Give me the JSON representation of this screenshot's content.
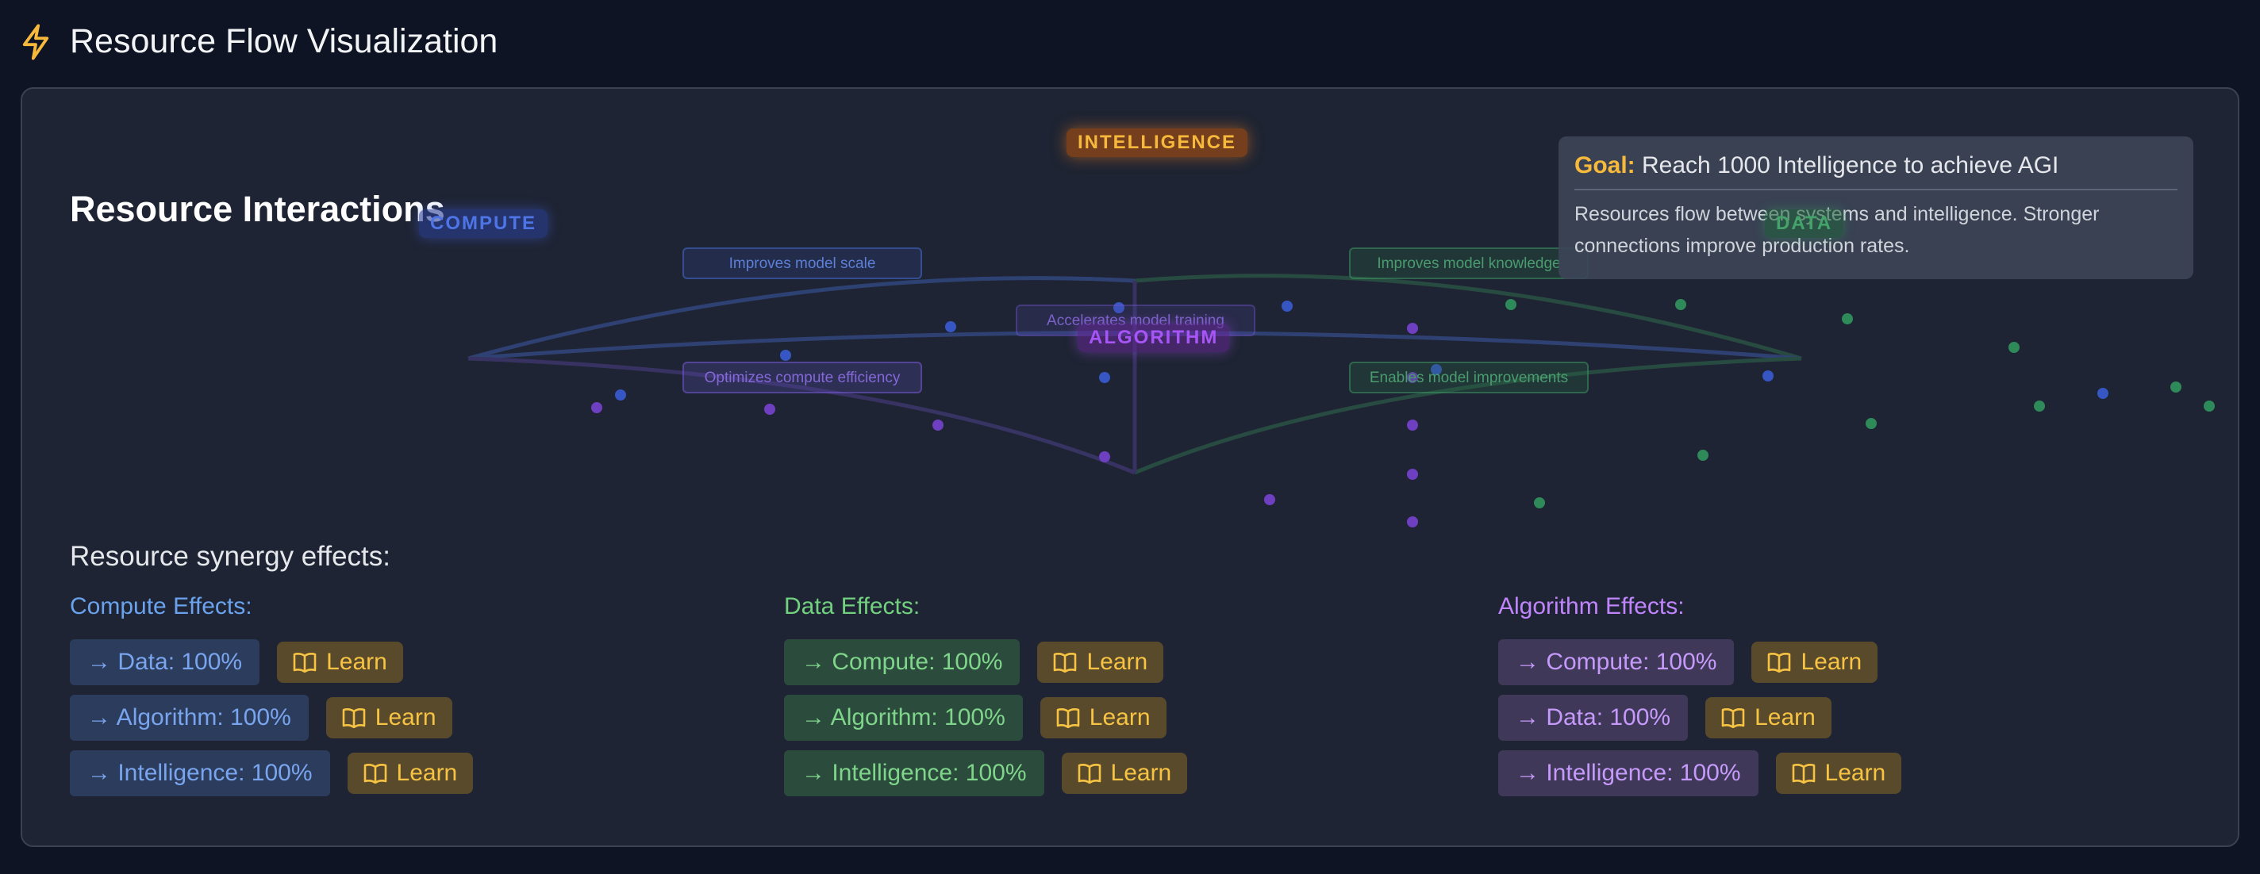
{
  "header": {
    "title": "Resource Flow Visualization",
    "icon": "lightning-bolt-icon"
  },
  "panel": {
    "section_title": "Resource Interactions",
    "goal": {
      "label": "Goal:",
      "text": "Reach 1000 Intelligence to achieve AGI",
      "description": "Resources flow between systems and intelligence. Stronger connections improve production rates."
    },
    "nodes": {
      "intelligence": "INTELLIGENCE",
      "compute": "COMPUTE",
      "data": "DATA",
      "algorithm": "ALGORITHM"
    },
    "edge_labels": {
      "compute_top": "Improves model scale",
      "compute_bottom": "Optimizes compute efficiency",
      "data_top": "Improves model knowledge",
      "data_bottom": "Enables model improvements",
      "center": "Accelerates model training"
    },
    "synergy_title": "Resource synergy effects:",
    "columns": [
      {
        "title": "Compute Effects:",
        "effects": [
          {
            "label": "→ Data: 100%",
            "learn": "Learn"
          },
          {
            "label": "→ Algorithm: 100%",
            "learn": "Learn"
          },
          {
            "label": "→ Intelligence: 100%",
            "learn": "Learn"
          }
        ]
      },
      {
        "title": "Data Effects:",
        "effects": [
          {
            "label": "→ Compute: 100%",
            "learn": "Learn"
          },
          {
            "label": "→ Algorithm: 100%",
            "learn": "Learn"
          },
          {
            "label": "→ Intelligence: 100%",
            "learn": "Learn"
          }
        ]
      },
      {
        "title": "Algorithm Effects:",
        "effects": [
          {
            "label": "→ Compute: 100%",
            "learn": "Learn"
          },
          {
            "label": "→ Data: 100%",
            "learn": "Learn"
          },
          {
            "label": "→ Intelligence: 100%",
            "learn": "Learn"
          }
        ]
      }
    ]
  },
  "colors": {
    "compute": "#4d75e6",
    "data": "#43a36a",
    "algorithm": "#a855f7",
    "intelligence": "#f6b93b",
    "learn_text": "#f6c343"
  }
}
